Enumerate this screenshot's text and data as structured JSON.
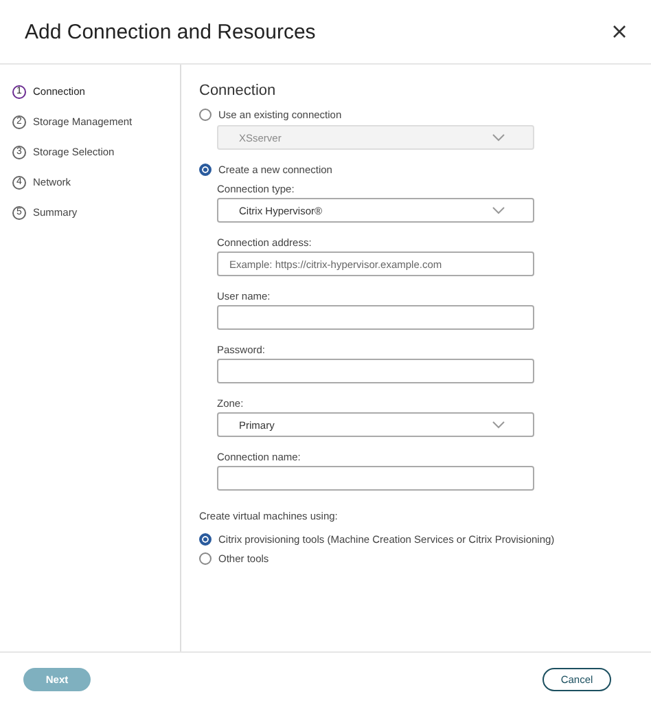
{
  "dialog": {
    "title": "Add Connection and Resources"
  },
  "steps": [
    {
      "number": "1",
      "label": "Connection",
      "selected": true
    },
    {
      "number": "2",
      "label": "Storage Management",
      "selected": false
    },
    {
      "number": "3",
      "label": "Storage Selection",
      "selected": false
    },
    {
      "number": "4",
      "label": "Network",
      "selected": false
    },
    {
      "number": "5",
      "label": "Summary",
      "selected": false
    }
  ],
  "section_title": "Connection",
  "existing_connection": {
    "label": "Use an existing connection",
    "selected": false,
    "dropdown": {
      "value": "XSserver",
      "disabled": true
    }
  },
  "new_connection": {
    "label": "Create a new connection",
    "selected": true,
    "fields": [
      {
        "kind": "select",
        "label": "Connection type:",
        "value": "Citrix Hypervisor®"
      },
      {
        "kind": "input",
        "label": "Connection address:",
        "placeholder": "Example: https://citrix-hypervisor.example.com"
      },
      {
        "kind": "input",
        "label": "User name:"
      },
      {
        "kind": "password",
        "label": "Password:"
      },
      {
        "kind": "select",
        "label": "Zone:",
        "value": "Primary"
      },
      {
        "kind": "input",
        "label": "Connection name:"
      }
    ]
  },
  "vm_tools": {
    "label": "Create virtual machines using:",
    "options": [
      {
        "label": "Citrix provisioning tools (Machine Creation Services or Citrix Provisioning)",
        "selected": true
      },
      {
        "label": "Other tools",
        "selected": false
      }
    ]
  },
  "buttons": {
    "next": {
      "label": "Next",
      "disabled": true
    },
    "cancel": {
      "label": "Cancel"
    }
  }
}
